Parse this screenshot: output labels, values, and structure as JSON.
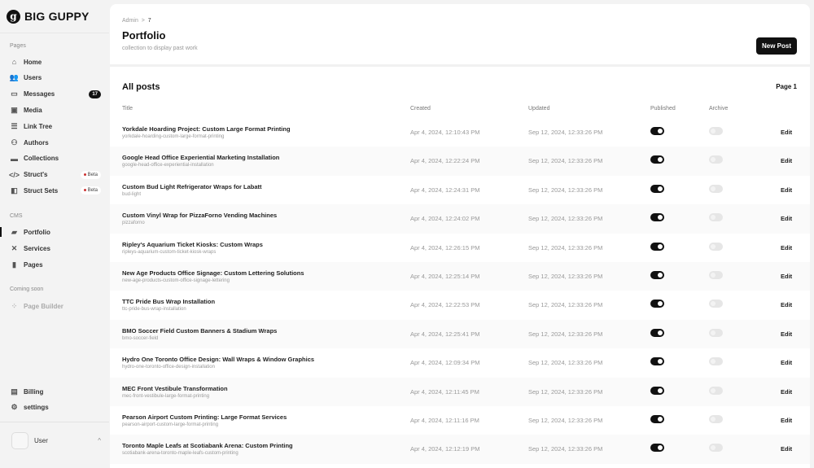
{
  "brand": {
    "name": "BIG GUPPY",
    "mark": "g"
  },
  "sidebar": {
    "pages_label": "Pages",
    "items": [
      {
        "label": "Home",
        "icon": "⌂"
      },
      {
        "label": "Users",
        "icon": "👥"
      },
      {
        "label": "Messages",
        "icon": "▭",
        "badge": "17"
      },
      {
        "label": "Media",
        "icon": "▣"
      },
      {
        "label": "Link Tree",
        "icon": "☰"
      },
      {
        "label": "Authors",
        "icon": "⚇"
      },
      {
        "label": "Collections",
        "icon": "▬"
      },
      {
        "label": "Struct's",
        "icon": "</>",
        "beta": "Beta"
      },
      {
        "label": "Struct Sets",
        "icon": "◧",
        "beta": "Beta"
      }
    ],
    "cms_label": "CMS",
    "cms_items": [
      {
        "label": "Portfolio",
        "icon": "▰"
      },
      {
        "label": "Services",
        "icon": "✕"
      },
      {
        "label": "Pages",
        "icon": "▮"
      }
    ],
    "soon_label": "Coming soon",
    "soon_items": [
      {
        "label": "Page Builder",
        "icon": "⁘"
      }
    ],
    "bottom_items": [
      {
        "label": "Billing",
        "icon": "▤"
      },
      {
        "label": "settings",
        "icon": "⚙"
      }
    ],
    "user": {
      "name": "User",
      "chevron": "^"
    }
  },
  "header": {
    "breadcrumb": [
      "Admin",
      "7"
    ],
    "breadcrumb_sep": ">",
    "title": "Portfolio",
    "subtitle": "collection to display past work",
    "new_post": "New Post"
  },
  "list": {
    "title": "All posts",
    "page": "Page 1",
    "columns": [
      "Title",
      "Created",
      "Updated",
      "Published",
      "Archive"
    ],
    "edit_label": "Edit",
    "rows": [
      {
        "title": "Yorkdale Hoarding Project: Custom Large Format Printing",
        "slug": "yorkdale-hoarding-custom-large-format-printing",
        "created": "Apr 4, 2024, 12:10:43 PM",
        "updated": "Sep 12, 2024, 12:33:26 PM",
        "published": true,
        "archive": false
      },
      {
        "title": "Google Head Office Experiential Marketing Installation",
        "slug": "google-head-office-experiential-installation",
        "created": "Apr 4, 2024, 12:22:24 PM",
        "updated": "Sep 12, 2024, 12:33:26 PM",
        "published": true,
        "archive": false
      },
      {
        "title": "Custom Bud Light Refrigerator Wraps for Labatt",
        "slug": "bud-light",
        "created": "Apr 4, 2024, 12:24:31 PM",
        "updated": "Sep 12, 2024, 12:33:26 PM",
        "published": true,
        "archive": false
      },
      {
        "title": "Custom Vinyl Wrap for PizzaForno Vending Machines",
        "slug": "pizzaforno",
        "created": "Apr 4, 2024, 12:24:02 PM",
        "updated": "Sep 12, 2024, 12:33:26 PM",
        "published": true,
        "archive": false
      },
      {
        "title": "Ripley's Aquarium Ticket Kiosks: Custom Wraps",
        "slug": "ripleys-aquarium-custom-ticket-kiosk-wraps",
        "created": "Apr 4, 2024, 12:26:15 PM",
        "updated": "Sep 12, 2024, 12:33:26 PM",
        "published": true,
        "archive": false
      },
      {
        "title": "New Age Products Office Signage: Custom Lettering Solutions",
        "slug": "new-age-products-custom-office-signage-lettering",
        "created": "Apr 4, 2024, 12:25:14 PM",
        "updated": "Sep 12, 2024, 12:33:26 PM",
        "published": true,
        "archive": false
      },
      {
        "title": "TTC Pride Bus Wrap Installation",
        "slug": "ttc-pride-bus-wrap-installation",
        "created": "Apr 4, 2024, 12:22:53 PM",
        "updated": "Sep 12, 2024, 12:33:26 PM",
        "published": true,
        "archive": false
      },
      {
        "title": "BMO Soccer Field Custom Banners & Stadium Wraps",
        "slug": "bmo-soccer-field",
        "created": "Apr 4, 2024, 12:25:41 PM",
        "updated": "Sep 12, 2024, 12:33:26 PM",
        "published": true,
        "archive": false
      },
      {
        "title": "Hydro One Toronto Office Design: Wall Wraps & Window Graphics",
        "slug": "hydro-one-toronto-office-design-installation",
        "created": "Apr 4, 2024, 12:09:34 PM",
        "updated": "Sep 12, 2024, 12:33:26 PM",
        "published": true,
        "archive": false
      },
      {
        "title": "MEC Front Vestibule Transformation",
        "slug": "mec-front-vestibule-large-format-printing",
        "created": "Apr 4, 2024, 12:11:45 PM",
        "updated": "Sep 12, 2024, 12:33:26 PM",
        "published": true,
        "archive": false
      },
      {
        "title": "Pearson Airport Custom Printing: Large Format Services",
        "slug": "pearson-airport-custom-large-format-printing",
        "created": "Apr 4, 2024, 12:11:16 PM",
        "updated": "Sep 12, 2024, 12:33:26 PM",
        "published": true,
        "archive": false
      },
      {
        "title": "Toronto Maple Leafs at Scotiabank Arena: Custom Printing",
        "slug": "scotiabank-arena-toronto-maple-leafs-custom-printing",
        "created": "Apr 4, 2024, 12:12:19 PM",
        "updated": "Sep 12, 2024, 12:33:26 PM",
        "published": true,
        "archive": false
      }
    ]
  }
}
